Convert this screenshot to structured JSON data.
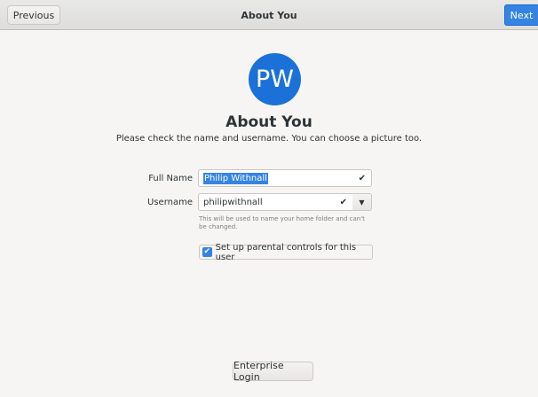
{
  "header": {
    "previous_label": "Previous",
    "title": "About You",
    "next_label": "Next"
  },
  "avatar": {
    "initials": "PW",
    "color": "#1c71d8"
  },
  "main": {
    "heading": "About You",
    "subtitle": "Please check the name and username. You can choose a picture too."
  },
  "form": {
    "full_name_label": "Full Name",
    "full_name_value": "Philip Withnall",
    "username_label": "Username",
    "username_value": "philipwithnall",
    "hint": "This will be used to name your home folder and can't be changed.",
    "parental_controls_label": "Set up parental controls for this user",
    "parental_controls_checked": true
  },
  "footer": {
    "enterprise_login_label": "Enterprise Login"
  },
  "colors": {
    "accent": "#3584e4",
    "background": "#f6f5f4"
  },
  "icons": {
    "valid": "checkmark-icon",
    "dropdown": "chevron-down-icon"
  }
}
